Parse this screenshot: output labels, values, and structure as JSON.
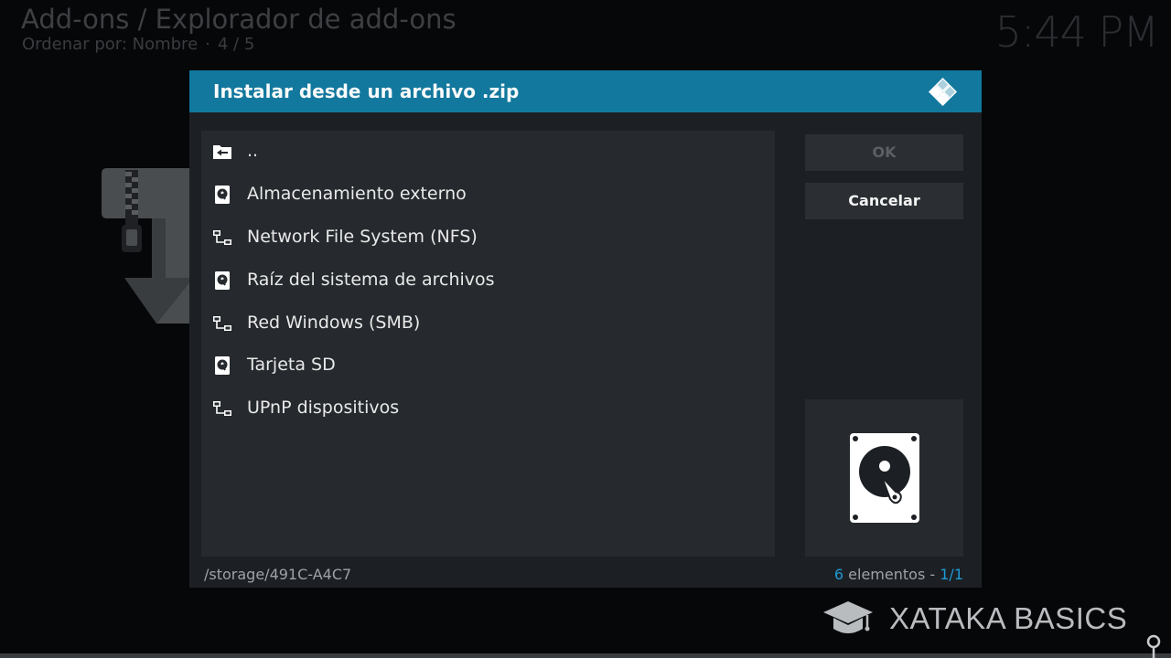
{
  "background": {
    "title": "Add-ons / Explorador de add-ons",
    "sort_label": "Ordenar por: Nombre",
    "sort_separator": "·",
    "page_indicator": "4 / 5",
    "clock": "5:44 PM"
  },
  "dialog": {
    "title": "Instalar desde un archivo .zip",
    "logo_icon": "kodi-logo-icon",
    "items": [
      {
        "label": "..",
        "icon": "folder-back-icon"
      },
      {
        "label": "Almacenamiento externo",
        "icon": "hard-drive-icon"
      },
      {
        "label": "Network File System (NFS)",
        "icon": "network-icon"
      },
      {
        "label": "Raíz del sistema de archivos",
        "icon": "hard-drive-icon"
      },
      {
        "label": "Red Windows (SMB)",
        "icon": "network-icon"
      },
      {
        "label": "Tarjeta SD",
        "icon": "hard-drive-icon"
      },
      {
        "label": "UPnP dispositivos",
        "icon": "network-icon"
      }
    ],
    "buttons": {
      "ok_label": "OK",
      "cancel_label": "Cancelar"
    },
    "preview_icon": "hard-drive-icon",
    "path": "/storage/491C-A4C7",
    "count": {
      "number": "6",
      "label": "elementos",
      "separator": "-",
      "page": "1/1"
    }
  },
  "watermark": {
    "text": "XATAKA BASICS",
    "icon": "graduation-cap-icon"
  },
  "colors": {
    "header": "#12789d",
    "accent": "#1c9bd6",
    "dialog_bg": "#1c2024",
    "panel_bg": "#262a2e"
  }
}
